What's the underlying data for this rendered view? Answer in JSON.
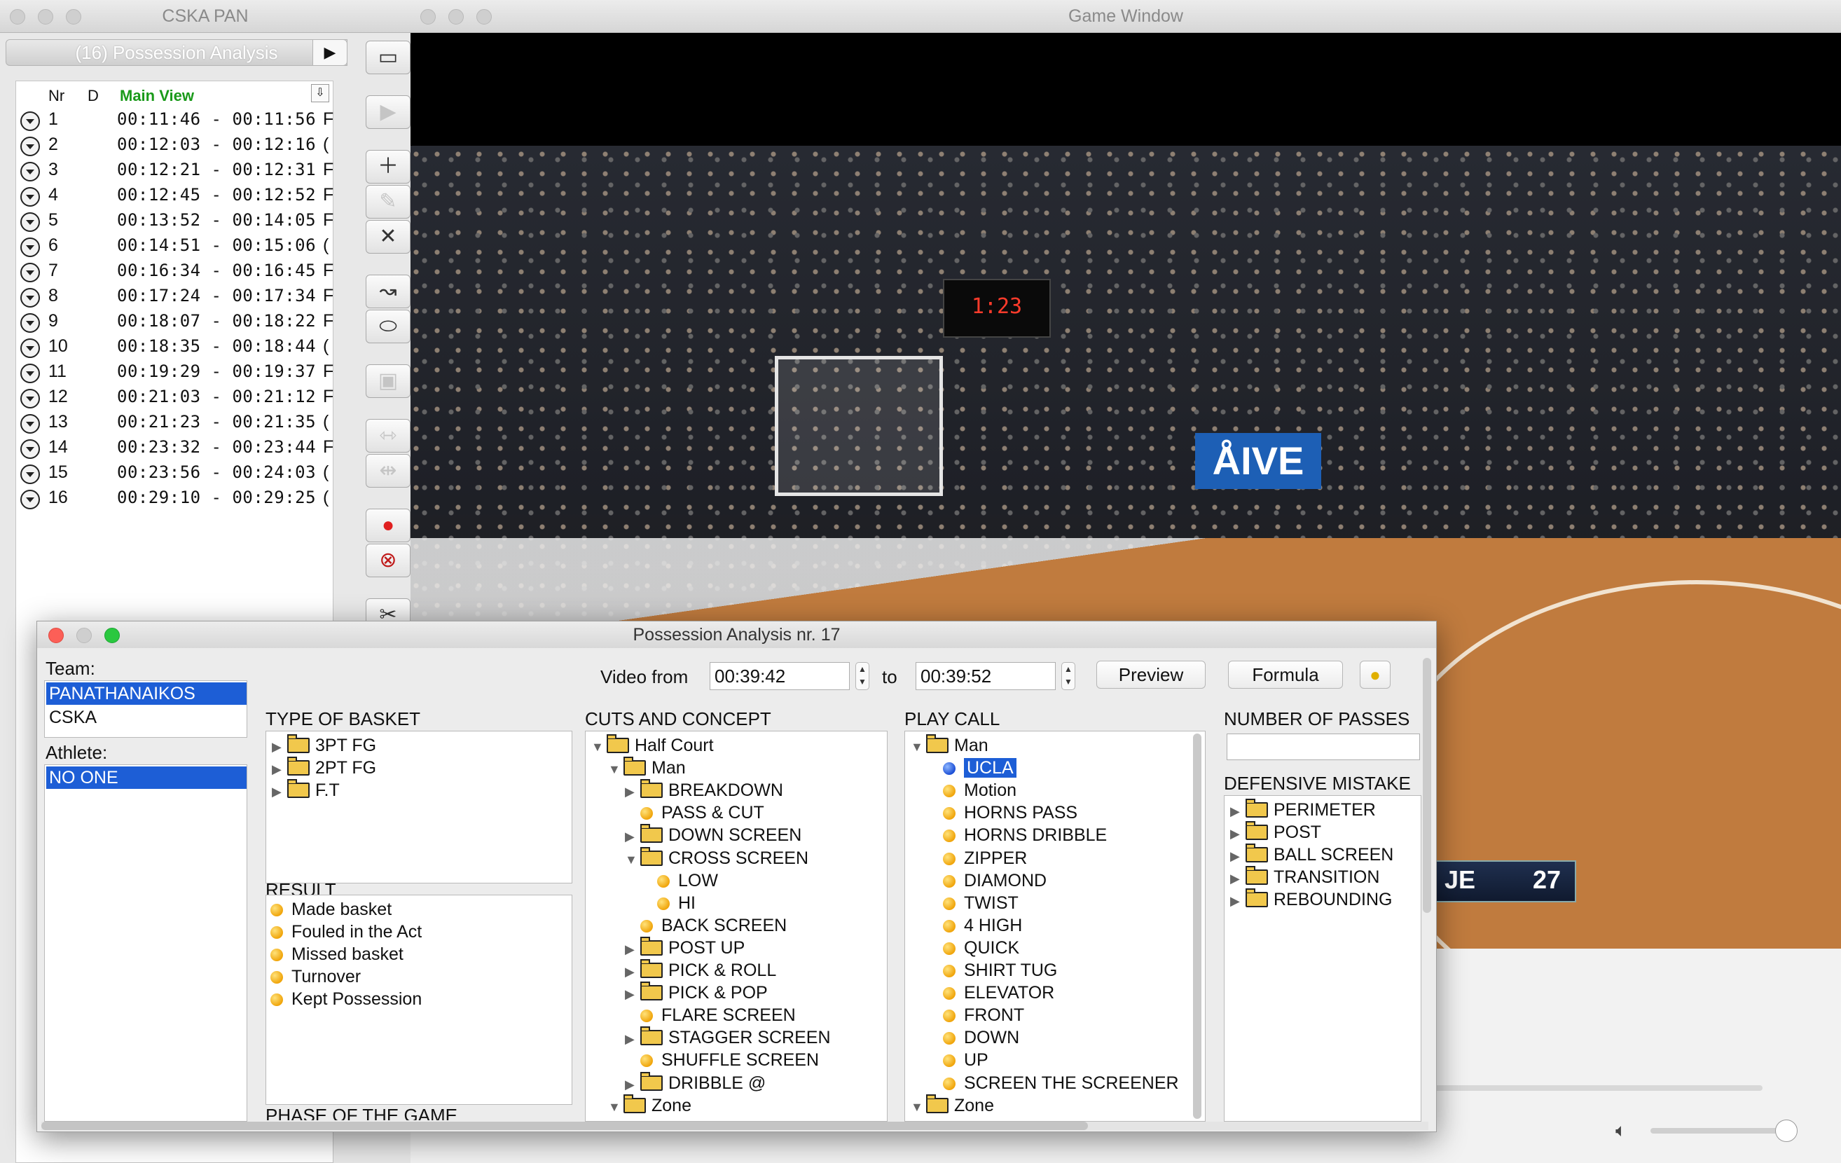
{
  "cska_window": {
    "title": "CSKA PAN",
    "selector_label": "(16) Possession Analysis",
    "columns": {
      "nr": "Nr",
      "d": "D",
      "main_view": "Main View"
    },
    "rows": [
      {
        "nr": "1",
        "time": "00:11:46 - 00:11:56",
        "ext": "F"
      },
      {
        "nr": "2",
        "time": "00:12:03 - 00:12:16",
        "ext": "("
      },
      {
        "nr": "3",
        "time": "00:12:21 - 00:12:31",
        "ext": "F"
      },
      {
        "nr": "4",
        "time": "00:12:45 - 00:12:52",
        "ext": "F"
      },
      {
        "nr": "5",
        "time": "00:13:52 - 00:14:05",
        "ext": "F"
      },
      {
        "nr": "6",
        "time": "00:14:51 - 00:15:06",
        "ext": "("
      },
      {
        "nr": "7",
        "time": "00:16:34 - 00:16:45",
        "ext": "F"
      },
      {
        "nr": "8",
        "time": "00:17:24 - 00:17:34",
        "ext": "F"
      },
      {
        "nr": "9",
        "time": "00:18:07 - 00:18:22",
        "ext": "F"
      },
      {
        "nr": "10",
        "time": "00:18:35 - 00:18:44",
        "ext": "("
      },
      {
        "nr": "11",
        "time": "00:19:29 - 00:19:37",
        "ext": "F"
      },
      {
        "nr": "12",
        "time": "00:21:03 - 00:21:12",
        "ext": "F"
      },
      {
        "nr": "13",
        "time": "00:21:23 - 00:21:35",
        "ext": "("
      },
      {
        "nr": "14",
        "time": "00:23:32 - 00:23:44",
        "ext": "F"
      },
      {
        "nr": "15",
        "time": "00:23:56 - 00:24:03",
        "ext": "("
      },
      {
        "nr": "16",
        "time": "00:29:10 - 00:29:25",
        "ext": "("
      }
    ]
  },
  "game_window": {
    "title": "Game Window",
    "scorebug": {
      "team": "JE",
      "score": "27"
    },
    "shot_clock": "1:23",
    "banner": "ÅIVE"
  },
  "possession_window": {
    "title": "Possession Analysis nr. 17",
    "team_label": "Team:",
    "teams": [
      "PANATHANAIKOS",
      "CSKA"
    ],
    "athlete_label": "Athlete:",
    "athletes": [
      "NO ONE"
    ],
    "video_from_label": "Video from",
    "video_from": "00:39:42",
    "to_label": "to",
    "video_to": "00:39:52",
    "preview_label": "Preview",
    "formula_label": "Formula",
    "type_of_basket": {
      "label": "TYPE OF BASKET",
      "items": [
        "3PT FG",
        "2PT FG",
        "F.T"
      ]
    },
    "result": {
      "label": "RESULT",
      "items": [
        "Made basket",
        "Fouled in the Act",
        "Missed basket",
        "Turnover",
        "Kept Possession"
      ]
    },
    "phase_label": "PHASE OF THE GAME",
    "cuts": {
      "label": "CUTS AND CONCEPT",
      "items": [
        "Half Court",
        "Man",
        "BREAKDOWN",
        "PASS & CUT",
        "DOWN SCREEN",
        "CROSS SCREEN",
        "LOW",
        "HI",
        "BACK SCREEN",
        "POST UP",
        "PICK & ROLL",
        "PICK & POP",
        "FLARE SCREEN",
        "STAGGER SCREEN",
        "SHUFFLE SCREEN",
        "DRIBBLE @",
        "Zone"
      ]
    },
    "play_call": {
      "label": "PLAY CALL",
      "items": [
        "Man",
        "UCLA",
        "Motion",
        "HORNS PASS",
        "HORNS DRIBBLE",
        "ZIPPER",
        "DIAMOND",
        "TWIST",
        "4 HIGH",
        "QUICK",
        "SHIRT TUG",
        "ELEVATOR",
        "FRONT",
        "DOWN",
        "UP",
        "SCREEN THE SCREENER",
        "Zone"
      ]
    },
    "passes_label": "NUMBER OF PASSES",
    "passes_value": "",
    "defensive": {
      "label": "DEFENSIVE MISTAKE",
      "items": [
        "PERIMETER",
        "POST",
        "BALL SCREEN",
        "TRANSITION",
        "REBOUNDING"
      ]
    }
  }
}
